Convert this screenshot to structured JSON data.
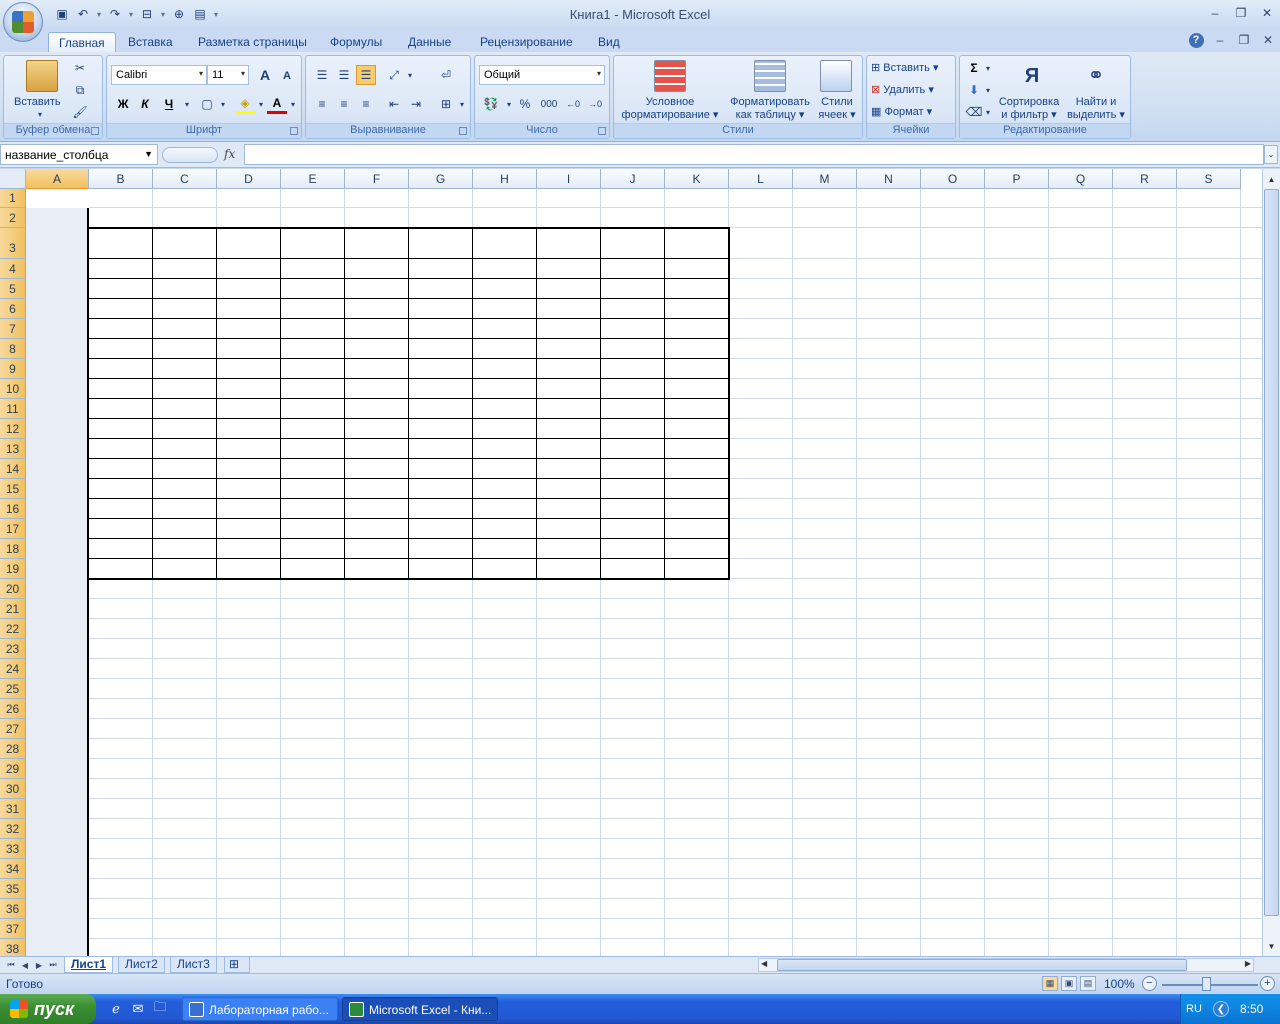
{
  "window": {
    "title": "Книга1 - Microsoft Excel",
    "controls": [
      "–",
      "❐",
      "✕"
    ],
    "doc_controls": [
      "–",
      "❐",
      "✕"
    ]
  },
  "quick_access": {
    "icons": [
      "save-icon",
      "undo-icon",
      "redo-icon",
      "print-preview-icon",
      "spell-icon",
      "clipboard-icon",
      "customize-icon"
    ]
  },
  "tabs": [
    {
      "label": "Главная",
      "active": true
    },
    {
      "label": "Вставка",
      "active": false
    },
    {
      "label": "Разметка страницы",
      "active": false
    },
    {
      "label": "Формулы",
      "active": false
    },
    {
      "label": "Данные",
      "active": false
    },
    {
      "label": "Рецензирование",
      "active": false
    },
    {
      "label": "Вид",
      "active": false
    }
  ],
  "ribbon": {
    "clipboard": {
      "label": "Буфер обмена",
      "paste": "Вставить"
    },
    "font": {
      "label": "Шрифт",
      "name": "Calibri",
      "size": "11",
      "bold": "Ж",
      "italic": "К",
      "underline": "Ч",
      "grow": "A",
      "shrink": "A"
    },
    "alignment": {
      "label": "Выравнивание"
    },
    "number": {
      "label": "Число",
      "format": "Общий",
      "percent": "%",
      "thousands": "000"
    },
    "styles": {
      "label": "Стили",
      "conditional": "Условное форматирование",
      "conditional_l1": "Условное",
      "conditional_l2": "форматирование",
      "format_table_l1": "Форматировать",
      "format_table_l2": "как таблицу",
      "cell_styles_l1": "Стили",
      "cell_styles_l2": "ячеек"
    },
    "cells": {
      "label": "Ячейки",
      "insert": "Вставить",
      "delete": "Удалить",
      "format": "Формат"
    },
    "editing": {
      "label": "Редактирование",
      "sort_l1": "Сортировка",
      "sort_l2": "и фильтр",
      "find_l1": "Найти и",
      "find_l2": "выделить"
    }
  },
  "formula_bar": {
    "name_box": "название_столбца",
    "fx": "fx",
    "formula": ""
  },
  "sheet": {
    "columns": [
      "A",
      "B",
      "C",
      "D",
      "E",
      "F",
      "G",
      "H",
      "I",
      "J",
      "K",
      "L",
      "M",
      "N",
      "O",
      "P",
      "Q",
      "R",
      "S"
    ],
    "rows": [
      "1",
      "2",
      "3",
      "4",
      "5",
      "6",
      "7",
      "8",
      "9",
      "10",
      "11",
      "12",
      "13",
      "14",
      "15",
      "16",
      "17",
      "18",
      "19",
      "20",
      "21",
      "22",
      "23",
      "24",
      "25",
      "26",
      "27",
      "28",
      "29",
      "30",
      "31",
      "32",
      "33",
      "34",
      "35",
      "36",
      "37",
      "38"
    ],
    "selected_column": "A"
  },
  "sheet_tabs": [
    {
      "label": "Лист1",
      "active": true
    },
    {
      "label": "Лист2",
      "active": false
    },
    {
      "label": "Лист3",
      "active": false
    }
  ],
  "status": {
    "ready": "Готово",
    "zoom": "100%"
  },
  "taskbar": {
    "start": "пуск",
    "buttons": [
      {
        "label": "Лабораторная рабо...",
        "active": false
      },
      {
        "label": "Microsoft Excel - Кни...",
        "active": true
      }
    ],
    "lang": "RU",
    "clock": "8:50"
  }
}
